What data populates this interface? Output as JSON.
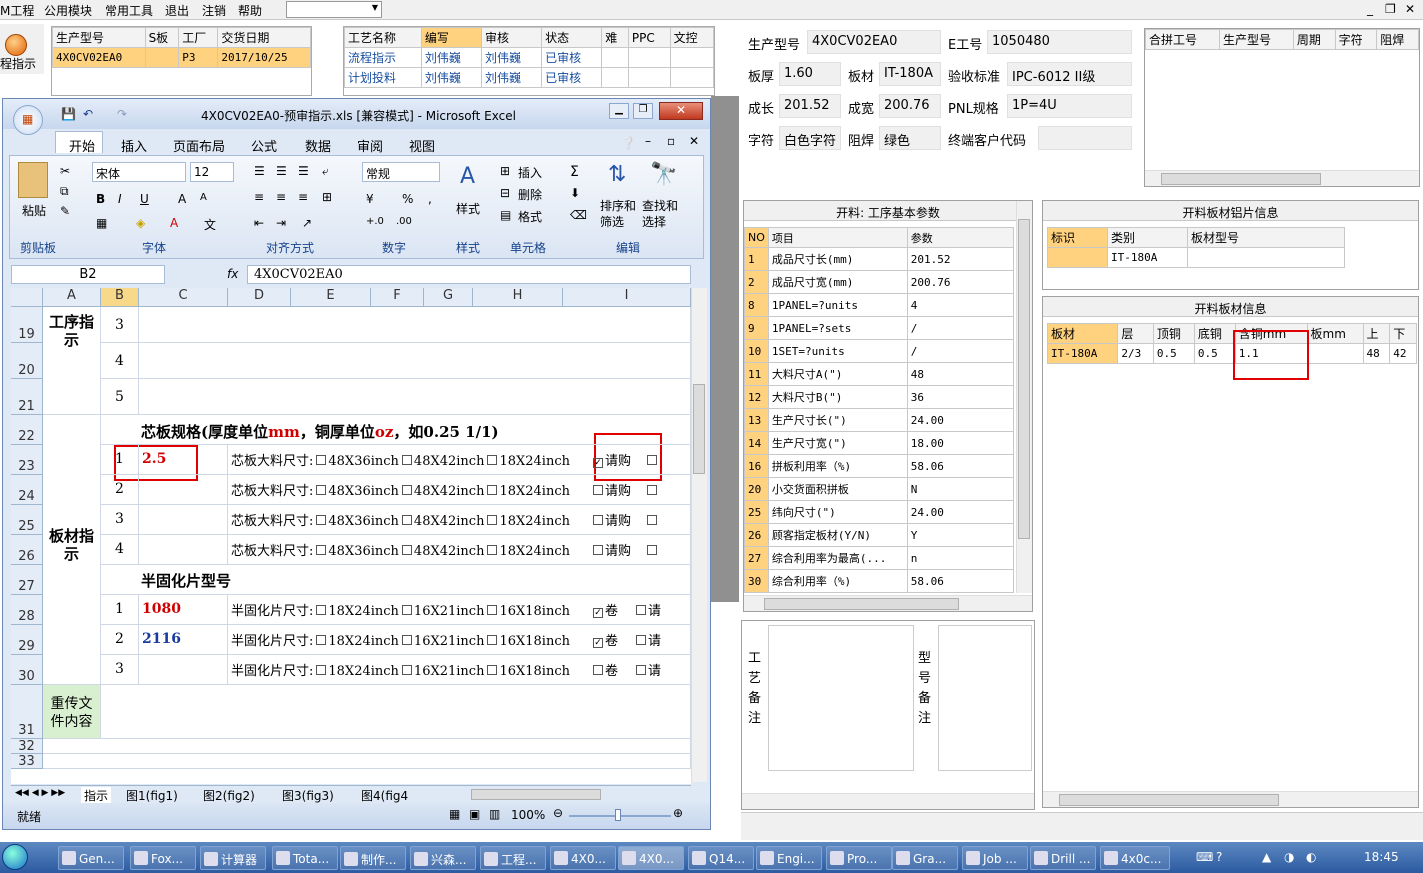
{
  "menu": {
    "items": [
      "M工程",
      "公用模块",
      "常用工具",
      "退出",
      "注销",
      "帮助"
    ]
  },
  "left_button": {
    "label": "程指示"
  },
  "order_table": {
    "headers": [
      "生产型号",
      "S板",
      "工厂",
      "交货日期"
    ],
    "row": [
      "4X0CV02EA0",
      "P3",
      "2017/10/25"
    ]
  },
  "process_table": {
    "headers": [
      "工艺名称",
      "编写",
      "审核",
      "状态",
      "难",
      "PPC",
      "文控"
    ],
    "rows": [
      [
        "流程指示",
        "刘伟巍",
        "刘伟巍",
        "已审核"
      ],
      [
        "计划投料",
        "刘伟巍",
        "刘伟巍",
        "已审核"
      ]
    ]
  },
  "info": {
    "model_label": "生产型号",
    "model": "4X0CV02EA0",
    "e_label": "E工号",
    "e_no": "1050480",
    "thick_label": "板厚",
    "thick": "1.60",
    "mat_label": "板材",
    "mat": "IT-180A",
    "std_label": "验收标准",
    "std": "IPC-6012 II级",
    "len_label": "成长",
    "len": "201.52",
    "wid_label": "成宽",
    "wid": "200.76",
    "pnl_label": "PNL规格",
    "pnl": "1P=4U",
    "char_label": "字符",
    "char": "白色字符",
    "mask_label": "阻焊",
    "mask": "绿色",
    "cust_label": "终端客户代码"
  },
  "merge_table": {
    "headers": [
      "合拼工号",
      "生产型号",
      "周期",
      "字符",
      "阻焊"
    ]
  },
  "params": {
    "title": "开料: 工序基本参数",
    "headers": [
      "NO",
      "项目",
      "参数"
    ],
    "rows": [
      [
        "1",
        "成品尺寸长(mm)",
        "201.52"
      ],
      [
        "2",
        "成品尺寸宽(mm)",
        "200.76"
      ],
      [
        "8",
        "1PANEL=?units",
        "4"
      ],
      [
        "9",
        "1PANEL=?sets",
        "/"
      ],
      [
        "10",
        "1SET=?units",
        "/"
      ],
      [
        "11",
        "大料尺寸A(\")",
        "48"
      ],
      [
        "12",
        "大料尺寸B(\")",
        "36"
      ],
      [
        "13",
        "生产尺寸长(\")",
        "24.00"
      ],
      [
        "14",
        "生产尺寸宽(\")",
        "18.00"
      ],
      [
        "16",
        "拼板利用率（%)",
        "58.06"
      ],
      [
        "20",
        "小交货面积拼板",
        "N"
      ],
      [
        "25",
        "纬向尺寸(\")",
        "24.00"
      ],
      [
        "26",
        "顾客指定板材(Y/N)",
        "Y"
      ],
      [
        "27",
        "综合利用率为最高(...",
        "n"
      ],
      [
        "30",
        "综合利用率（%)",
        "58.06"
      ]
    ]
  },
  "sheet_info": {
    "title": "开料板材铝片信息",
    "headers": [
      "标识",
      "类别",
      "板材型号"
    ],
    "row": [
      "",
      "IT-180A",
      ""
    ]
  },
  "board_info": {
    "title": "开料板材信息",
    "headers": [
      "板材",
      "层",
      "顶铜",
      "底铜",
      "含铜mm",
      "板mm",
      "上",
      "下"
    ],
    "row": [
      "IT-180A",
      "2/3",
      "0.5",
      "0.5",
      "1.1",
      "",
      "48",
      "42"
    ]
  },
  "remarks": {
    "process": "工艺备注",
    "model": "型号备注"
  },
  "excel": {
    "title": "4X0CV02EA0-预审指示.xls  [兼容模式] - Microsoft Excel",
    "tabs": [
      "开始",
      "插入",
      "页面布局",
      "公式",
      "数据",
      "审阅",
      "视图"
    ],
    "font": "宋体",
    "font_size": "12",
    "number_format": "常规",
    "groups": [
      "剪贴板",
      "字体",
      "对齐方式",
      "数字",
      "样式",
      "单元格",
      "编辑"
    ],
    "buttons": {
      "paste": "粘贴",
      "style": "样式",
      "insert": "插入",
      "delete": "删除",
      "format": "格式",
      "sort": "排序和筛选",
      "find": "查找和选择"
    },
    "name_box": "B2",
    "formula": "4X0CV02EA0",
    "cols": [
      "A",
      "B",
      "C",
      "D",
      "E",
      "F",
      "G",
      "H",
      "I"
    ],
    "row_nums": [
      "19",
      "20",
      "21",
      "22",
      "23",
      "24",
      "25",
      "26",
      "27",
      "28",
      "29",
      "30",
      "31",
      "32",
      "33"
    ],
    "proc_label": "工序指示",
    "mat_label": "板材指示",
    "resend_label": "重传文件内容",
    "nums_a": [
      "3",
      "4",
      "5"
    ],
    "core_title": "芯板规格(厚度单位",
    "core_mm": "mm",
    "core_mid": "，铜厚单位",
    "core_oz": "oz",
    "core_ex": "，如0.25 1/1)",
    "core_rows": [
      {
        "n": "1",
        "v": "2.5",
        "buy": true
      },
      {
        "n": "2",
        "v": "",
        "buy": false
      },
      {
        "n": "3",
        "v": "",
        "buy": false
      },
      {
        "n": "4",
        "v": "",
        "buy": false
      }
    ],
    "core_size_label": "芯板大料尺寸:",
    "core_sizes": [
      "48X36inch",
      "48X42inch",
      "18X24inch"
    ],
    "buy": "请购",
    "pp_title": "半固化片型号",
    "pp_rows": [
      {
        "n": "1",
        "v": "1080",
        "roll": true
      },
      {
        "n": "2",
        "v": "2116",
        "roll": true
      },
      {
        "n": "3",
        "v": "",
        "roll": false
      }
    ],
    "pp_size_label": "半固化片尺寸:",
    "pp_sizes": [
      "18X24inch",
      "16X21inch",
      "16X18inch"
    ],
    "roll": "卷",
    "buy_short": "请",
    "sheets": [
      "指示",
      "图1(fig1)",
      "图2(fig2)",
      "图3(fig3)",
      "图4(fig4"
    ],
    "status": "就绪",
    "zoom": "100%"
  },
  "taskbar": {
    "items": [
      "Gen...",
      "Fox...",
      "计算器",
      "Tota...",
      "制作...",
      "兴森...",
      "工程...",
      "4X0...",
      "4X0...",
      "Q14...",
      "Engi...",
      "Pro...",
      "Gra...",
      "Job ...",
      "Drill ...",
      "4x0c..."
    ],
    "clock": "18:45"
  }
}
